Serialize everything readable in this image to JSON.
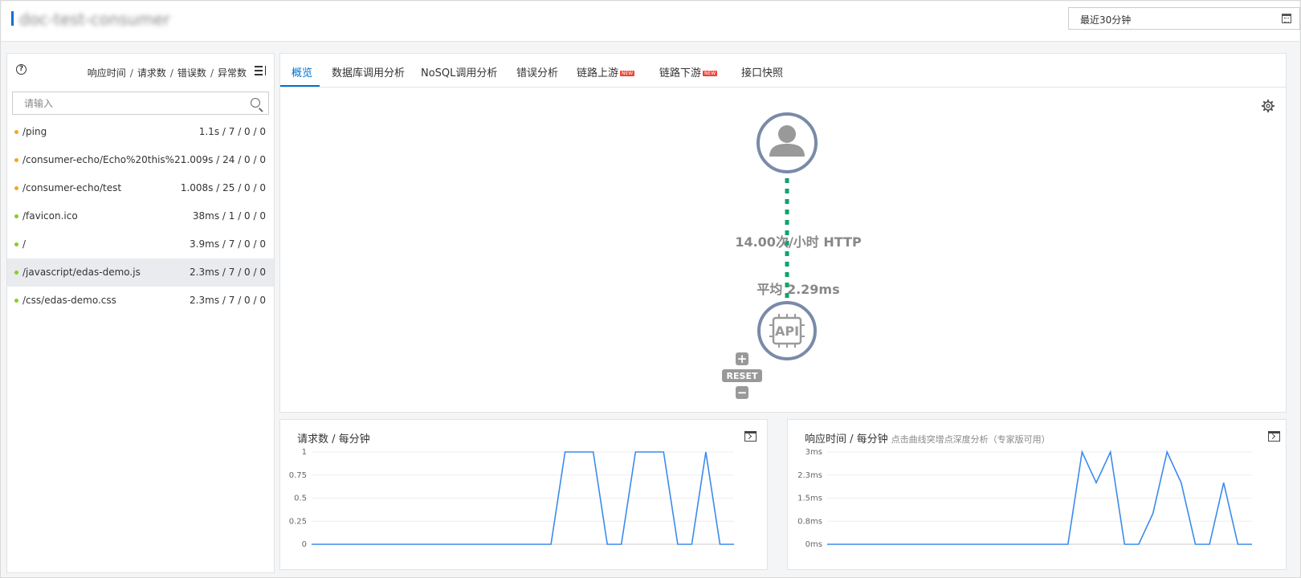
{
  "header": {
    "app_title": "doc-test-consumer",
    "time_range": "最近30分钟"
  },
  "sidebar": {
    "metrics_label": [
      "响应时间",
      "请求数",
      "错误数",
      "异常数"
    ],
    "separator": "/",
    "search_placeholder": "请输入",
    "items": [
      {
        "path": "/ping",
        "stats": "1.1s / 7 / 0 / 0",
        "status": "orange"
      },
      {
        "path": "/consumer-echo/Echo%20this%2...",
        "stats": "1.009s / 24 / 0 / 0",
        "status": "orange"
      },
      {
        "path": "/consumer-echo/test",
        "stats": "1.008s / 25 / 0 / 0",
        "status": "orange"
      },
      {
        "path": "/favicon.ico",
        "stats": "38ms / 1 / 0 / 0",
        "status": "green"
      },
      {
        "path": "/",
        "stats": "3.9ms / 7 / 0 / 0",
        "status": "green"
      },
      {
        "path": "/javascript/edas-demo.js",
        "stats": "2.3ms / 7 / 0 / 0",
        "status": "green",
        "selected": true
      },
      {
        "path": "/css/edas-demo.css",
        "stats": "2.3ms / 7 / 0 / 0",
        "status": "green"
      }
    ]
  },
  "tabs": [
    {
      "label": "概览",
      "active": true,
      "new": false
    },
    {
      "label": "数据库调用分析",
      "active": false,
      "new": false
    },
    {
      "label": "NoSQL调用分析",
      "active": false,
      "new": false
    },
    {
      "label": "错误分析",
      "active": false,
      "new": false
    },
    {
      "label": "链路上游",
      "active": false,
      "new": true
    },
    {
      "label": "链路下游",
      "active": false,
      "new": true
    },
    {
      "label": "接口快照",
      "active": false,
      "new": false
    }
  ],
  "new_badge": "NEW",
  "topology": {
    "rate_label": "14.00次/小时 HTTP",
    "avg_label": "平均 2.29ms",
    "api_label": "API",
    "reset_label": "RESET",
    "zoom_in": "+",
    "zoom_out": "−"
  },
  "colors": {
    "accent": "#0073ce",
    "node_ring": "#7a8aa8",
    "edge": "#0fa36b",
    "line": "#3b8bec"
  },
  "chart_data": [
    {
      "type": "line",
      "title": "请求数 / 每分钟",
      "ylim": [
        0,
        1
      ],
      "y_ticks": [
        "1",
        "0.75",
        "0.5",
        "0.25",
        "0"
      ],
      "values": [
        0,
        0,
        0,
        0,
        0,
        0,
        0,
        0,
        0,
        0,
        0,
        0,
        0,
        0,
        0,
        0,
        0,
        0,
        1,
        1,
        1,
        0,
        0,
        1,
        1,
        1,
        0,
        0,
        1,
        0,
        0
      ]
    },
    {
      "type": "line",
      "title": "响应时间 / 每分钟",
      "subtitle": "点击曲线突增点深度分析（专家版可用）",
      "ylim": [
        0,
        3
      ],
      "y_ticks": [
        "3ms",
        "2.3ms",
        "1.5ms",
        "0.8ms",
        "0ms"
      ],
      "values": [
        0,
        0,
        0,
        0,
        0,
        0,
        0,
        0,
        0,
        0,
        0,
        0,
        0,
        0,
        0,
        0,
        0,
        0,
        3,
        2,
        3,
        0,
        0,
        1,
        3,
        2,
        0,
        0,
        2,
        0,
        0
      ]
    }
  ]
}
